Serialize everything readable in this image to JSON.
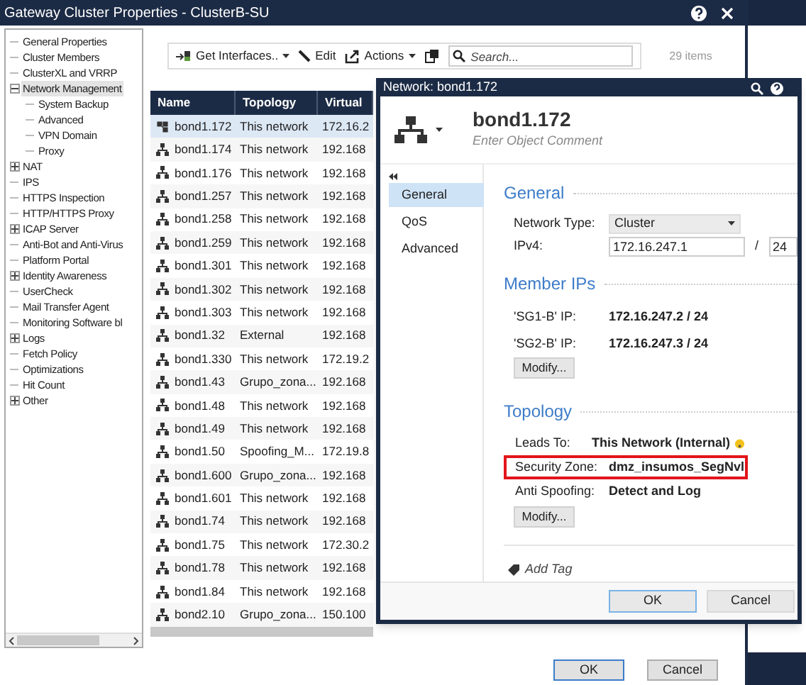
{
  "window": {
    "title": "Gateway Cluster Properties - ClusterB-SU"
  },
  "tree": [
    {
      "label": "General Properties",
      "kind": "leaf"
    },
    {
      "label": "Cluster Members",
      "kind": "leaf"
    },
    {
      "label": "ClusterXL and VRRP",
      "kind": "leaf"
    },
    {
      "label": "Network Management",
      "kind": "group",
      "expanded": true,
      "selected": true,
      "children": [
        {
          "label": "System Backup",
          "kind": "leaf"
        },
        {
          "label": "Advanced",
          "kind": "leaf"
        },
        {
          "label": "VPN Domain",
          "kind": "leaf"
        },
        {
          "label": "Proxy",
          "kind": "leaf"
        }
      ]
    },
    {
      "label": "NAT",
      "kind": "group",
      "expanded": false
    },
    {
      "label": "IPS",
      "kind": "leaf"
    },
    {
      "label": "HTTPS Inspection",
      "kind": "leaf"
    },
    {
      "label": "HTTP/HTTPS Proxy",
      "kind": "leaf"
    },
    {
      "label": "ICAP Server",
      "kind": "group",
      "expanded": false
    },
    {
      "label": "Anti-Bot and Anti-Virus",
      "kind": "leaf"
    },
    {
      "label": "Platform Portal",
      "kind": "leaf"
    },
    {
      "label": "Identity Awareness",
      "kind": "group",
      "expanded": false
    },
    {
      "label": "UserCheck",
      "kind": "leaf"
    },
    {
      "label": "Mail Transfer Agent",
      "kind": "leaf"
    },
    {
      "label": "Monitoring Software bl",
      "kind": "leaf"
    },
    {
      "label": "Logs",
      "kind": "group",
      "expanded": false
    },
    {
      "label": "Fetch Policy",
      "kind": "leaf"
    },
    {
      "label": "Optimizations",
      "kind": "leaf"
    },
    {
      "label": "Hit Count",
      "kind": "leaf"
    },
    {
      "label": "Other",
      "kind": "group",
      "expanded": false
    }
  ],
  "toolbar": {
    "buttons": [
      {
        "label": "Get Interfaces..",
        "kind": "import",
        "dropdown": true
      },
      {
        "label": "Edit",
        "kind": "edit",
        "dropdown": false
      },
      {
        "label": "Actions",
        "kind": "actions",
        "dropdown": true
      },
      {
        "kind": "copy",
        "dropdown": false
      }
    ],
    "search": {
      "placeholder": "Search..."
    },
    "count": "29 items"
  },
  "table": {
    "columns": [
      "Name",
      "Topology",
      "Virtual"
    ],
    "rows": [
      {
        "name": "bond1.172",
        "topology": "This network",
        "virtual": "172.16.2",
        "kind": "cluster",
        "selected": true
      },
      {
        "name": "bond1.174",
        "topology": "This network",
        "virtual": "192.168",
        "kind": "network",
        "selected": false
      },
      {
        "name": "bond1.176",
        "topology": "This network",
        "virtual": "192.168",
        "kind": "network",
        "selected": false
      },
      {
        "name": "bond1.257",
        "topology": "This network",
        "virtual": "192.168",
        "kind": "network",
        "selected": false
      },
      {
        "name": "bond1.258",
        "topology": "This network",
        "virtual": "192.168",
        "kind": "network",
        "selected": false
      },
      {
        "name": "bond1.259",
        "topology": "This network",
        "virtual": "192.168",
        "kind": "network",
        "selected": false
      },
      {
        "name": "bond1.301",
        "topology": "This network",
        "virtual": "192.168",
        "kind": "network",
        "selected": false
      },
      {
        "name": "bond1.302",
        "topology": "This network",
        "virtual": "192.168",
        "kind": "network",
        "selected": false
      },
      {
        "name": "bond1.303",
        "topology": "This network",
        "virtual": "192.168",
        "kind": "network",
        "selected": false
      },
      {
        "name": "bond1.32",
        "topology": "External",
        "virtual": "192.168",
        "kind": "network",
        "selected": false
      },
      {
        "name": "bond1.330",
        "topology": "This network",
        "virtual": "172.19.2",
        "kind": "network",
        "selected": false
      },
      {
        "name": "bond1.43",
        "topology": "Grupo_zona...",
        "virtual": "192.168",
        "kind": "network",
        "selected": false
      },
      {
        "name": "bond1.48",
        "topology": "This network",
        "virtual": "192.168",
        "kind": "network",
        "selected": false
      },
      {
        "name": "bond1.49",
        "topology": "This network",
        "virtual": "192.168",
        "kind": "network",
        "selected": false
      },
      {
        "name": "bond1.50",
        "topology": "Spoofing_M...",
        "virtual": "172.19.8",
        "kind": "network",
        "selected": false
      },
      {
        "name": "bond1.600",
        "topology": "Grupo_zona...",
        "virtual": "192.168",
        "kind": "network",
        "selected": false
      },
      {
        "name": "bond1.601",
        "topology": "This network",
        "virtual": "192.168",
        "kind": "network",
        "selected": false
      },
      {
        "name": "bond1.74",
        "topology": "This network",
        "virtual": "192.168",
        "kind": "network",
        "selected": false
      },
      {
        "name": "bond1.75",
        "topology": "This network",
        "virtual": "172.30.2",
        "kind": "network",
        "selected": false
      },
      {
        "name": "bond1.78",
        "topology": "This network",
        "virtual": "192.168",
        "kind": "network",
        "selected": false
      },
      {
        "name": "bond1.84",
        "topology": "This network",
        "virtual": "192.168",
        "kind": "network",
        "selected": false
      },
      {
        "name": "bond2.10",
        "topology": "Grupo_zona...",
        "virtual": "150.100",
        "kind": "network",
        "selected": false
      }
    ]
  },
  "buttons": [
    "OK",
    "Cancel"
  ],
  "dialog": {
    "title": "Network: bond1.172",
    "name": "bond1.172",
    "comment": {
      "placeholder": "Enter Object Comment"
    },
    "nav": [
      {
        "label": "General",
        "selected": true
      },
      {
        "label": "QoS",
        "selected": false
      },
      {
        "label": "Advanced",
        "selected": false
      }
    ],
    "general": {
      "heading": "General",
      "network_type_label": "Network Type:",
      "network_type": "Cluster",
      "ipv4_label": "IPv4:",
      "ipv4": "172.16.247.1",
      "slash": "/",
      "mask": "24"
    },
    "member_ips": {
      "heading": "Member IPs",
      "rows": [
        {
          "label": "'SG1-B' IP:",
          "value": "172.16.247.2 / 24"
        },
        {
          "label": "'SG2-B' IP:",
          "value": "172.16.247.3 / 24"
        }
      ],
      "button": "Modify..."
    },
    "topology": {
      "heading": "Topology",
      "rows": [
        {
          "label": "Leads To:",
          "value": "This Network (Internal)",
          "hint": true,
          "highlighted": false
        },
        {
          "label": "Security Zone:",
          "value": "dmz_insumos_SegNvl",
          "hint": false,
          "highlighted": true
        },
        {
          "label": "Anti Spoofing:",
          "value": "Detect and Log",
          "hint": false,
          "highlighted": false
        }
      ],
      "button": "Modify..."
    },
    "add_tag": "Add Tag",
    "buttons": [
      "OK",
      "Cancel"
    ]
  }
}
